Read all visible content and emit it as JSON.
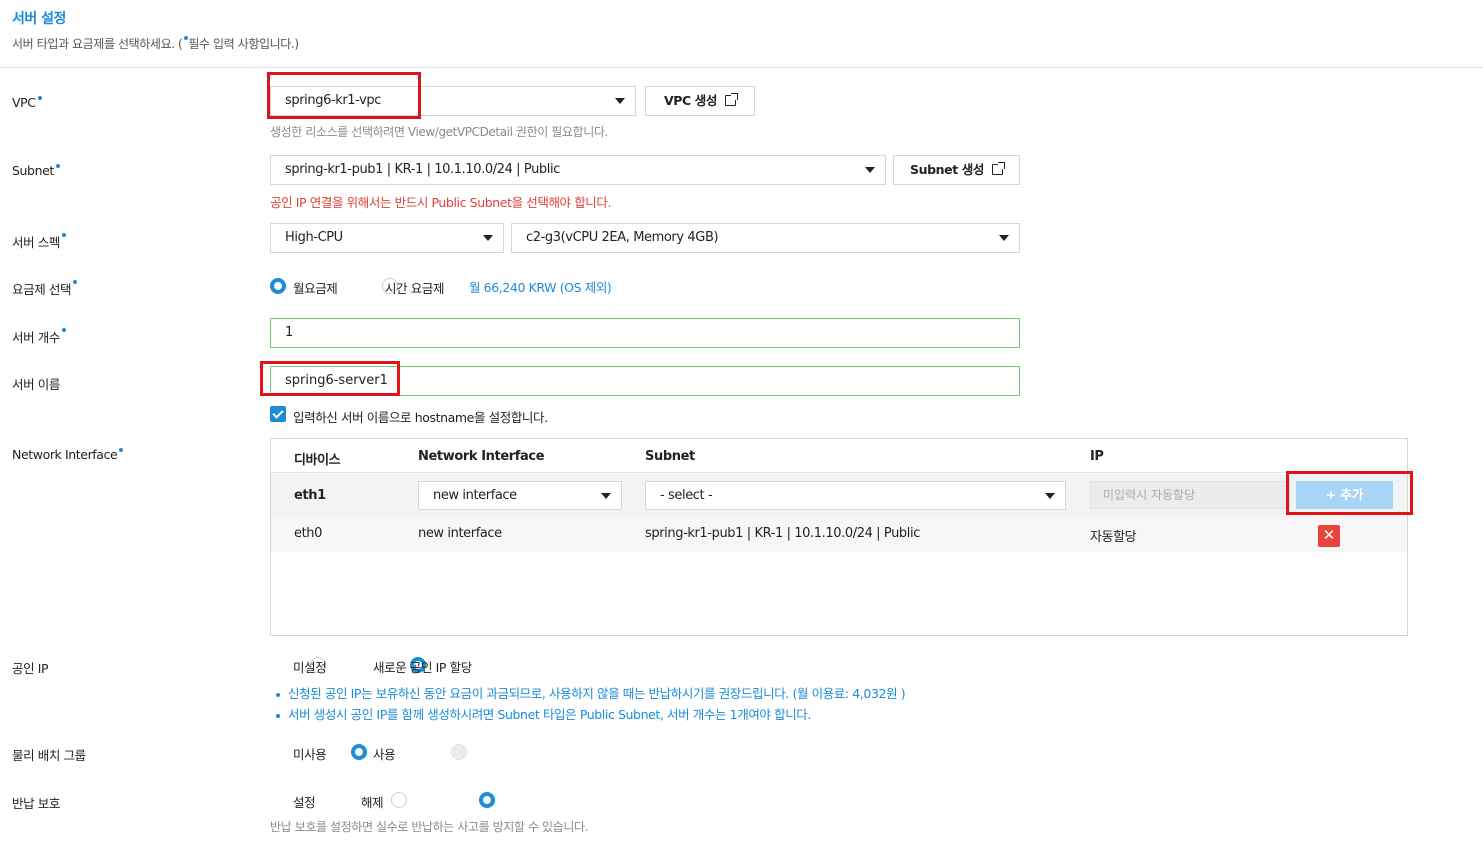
{
  "header": {
    "title": "서버 설정",
    "subtitle_pre": "서버 타입과 요금제를 선택하세요. (",
    "subtitle_post": "필수 입력 사항입니다.)"
  },
  "vpc": {
    "label": "VPC",
    "selected": "spring6-kr1-vpc",
    "create_button": "VPC 생성",
    "hint": "생성한 리소스를 선택하려면 View/getVPCDetail 권한이 필요합니다."
  },
  "subnet": {
    "label": "Subnet",
    "selected": "spring-kr1-pub1 | KR-1 | 10.1.10.0/24 | Public",
    "create_button": "Subnet 생성",
    "warning": "공인 IP 연결을 위해서는 반드시 Public Subnet을 선택해야 합니다."
  },
  "server_spec": {
    "label": "서버 스펙",
    "type": "High-CPU",
    "size": "c2-g3(vCPU 2EA, Memory 4GB)"
  },
  "pricing": {
    "label": "요금제 선택",
    "options": [
      "월요금제",
      "시간 요금제"
    ],
    "selected_index": 0,
    "price": "월 66,240 KRW (OS 제외)"
  },
  "server_count": {
    "label": "서버 개수",
    "value": "1"
  },
  "server_name": {
    "label": "서버 이름",
    "value": "spring6-server1",
    "hostname_checkbox": "입력하신 서버 이름으로 hostname을 설정합니다.",
    "hostname_checked": true
  },
  "network_interface": {
    "label": "Network Interface",
    "columns": [
      "디바이스",
      "Network Interface",
      "Subnet",
      "IP"
    ],
    "new_row": {
      "device": "eth1",
      "interface": "new interface",
      "subnet": "- select -",
      "ip_placeholder": "미입력시 자동할당",
      "add_button": "+ 추가"
    },
    "rows": [
      {
        "device": "eth0",
        "interface": "new interface",
        "subnet": "spring-kr1-pub1 | KR-1 | 10.1.10.0/24 | Public",
        "ip": "자동할당",
        "delete_icon": "✕"
      }
    ]
  },
  "public_ip": {
    "label": "공인 IP",
    "options": [
      "미설정",
      "새로운 공인 IP 할당"
    ],
    "selected_index": 1,
    "notes": [
      "신청된 공인 IP는 보유하신 동안 요금이 과금되므로, 사용하지 않을 때는 반납하시기를 권장드립니다. (월 이용료: 4,032원 )",
      "서버 생성시 공인 IP를 함께 생성하시려면 Subnet 타입은 Public Subnet, 서버 개수는 1개여야 합니다."
    ]
  },
  "placement_group": {
    "label": "물리 배치 그룹",
    "options": [
      "미사용",
      "사용"
    ],
    "selected_index": 0
  },
  "return_protection": {
    "label": "반납 보호",
    "options": [
      "설정",
      "해제"
    ],
    "selected_index": 1,
    "hint": "반납 보호를 설정하면 실수로 반납하는 사고를 방지할 수 있습니다."
  },
  "colors": {
    "accent": "#1a8cd8",
    "warning": "#e0413a",
    "highlight_box": "#e0141b",
    "valid_border": "#7cc576"
  }
}
